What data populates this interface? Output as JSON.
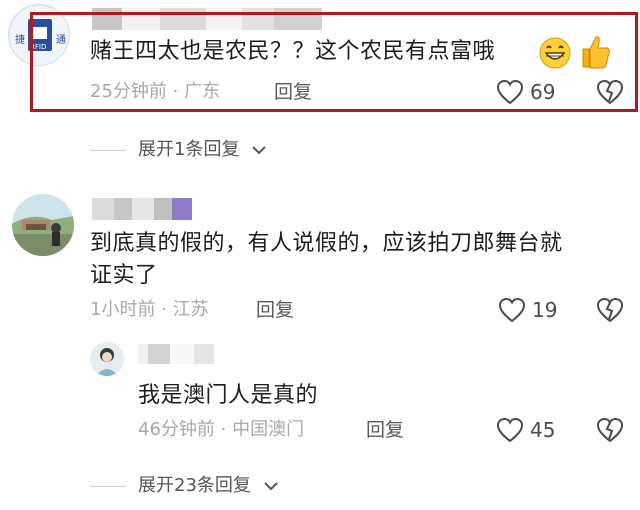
{
  "comments": [
    {
      "text": "赌王四太也是农民？？这个农民有点富哦",
      "time": "25分钟前",
      "location": "广东",
      "reply_label": "回复",
      "likes": "69",
      "avatar_text": [
        "捷",
        "通",
        "RFID"
      ],
      "emojis": [
        "grin-emoji",
        "thumbs-up-emoji"
      ]
    },
    {
      "text_line1": "到底真的假的，有人说假的，应该拍刀郎舞台就",
      "text_line2": "证实了",
      "time": "1小时前",
      "location": "江苏",
      "reply_label": "回复",
      "likes": "19"
    },
    {
      "text": "我是澳门人是真的",
      "time": "46分钟前",
      "location": "中国澳门",
      "reply_label": "回复",
      "likes": "45"
    }
  ],
  "expand_1": "展开1条回复",
  "expand_2": "展开23条回复",
  "meta_separator": "·",
  "colors": {
    "highlight_border": "#b3181c",
    "meta_text": "#a8a8a8",
    "body_text": "#1c1c1c"
  }
}
